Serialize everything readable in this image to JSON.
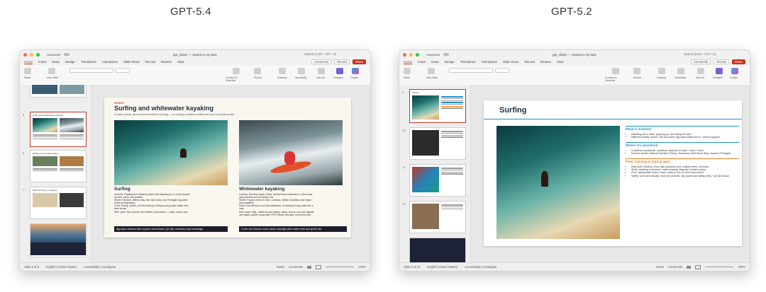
{
  "columns": {
    "left_title": "GPT-5.4",
    "right_title": "GPT-5.2"
  },
  "window": {
    "autosave": "AutoSave",
    "filename": "ppt_slides",
    "saved": "Saved to my Mac",
    "search_placeholder": "Search (Cmd + Ctrl + U)",
    "share": "Share",
    "comments": "Comments",
    "record": "Record",
    "tabs": [
      "Home",
      "Insert",
      "Draw",
      "Design",
      "Transitions",
      "Animations",
      "Slide Show",
      "Record",
      "Review",
      "View"
    ],
    "ribbon": {
      "paste": "Paste",
      "new_slide": "New Slide",
      "convert": "Convert to SmartArt",
      "picture": "Picture",
      "drawing": "Drawing",
      "sensitivity": "Sensitivity",
      "addins": "Add-ins",
      "designer": "Designer",
      "copilot": "Copilot"
    }
  },
  "left": {
    "slide_title": "Surfing and whitewater kayaking",
    "tag": "SPORTS",
    "subtitle": "In water sports, the environment itself is moving — so reading conditions matters as much as physical skill.",
    "surf_heading": "Surfing",
    "surf_text_1": "Involves: Paddling into breaking waves and standing up on a fine shaped",
    "surf_text_2": "by wind, swell, and seabed.",
    "surf_text_3": "Where: Pipeline, Jeffreys Bay, the Gold Coast, and Portugal's big-wave",
    "surf_text_4": "coast are legendary.",
    "surf_text_5": "Crest: Timing, rhythm, and the feeling of riding moving water rather than",
    "surf_text_6": "fixed terrain.",
    "surf_text_7": "Risk / gear: Rip currents, reef breaks, hold-downs — leash, board, wax.",
    "surf_bar": "Big-wave versions often require rescue teams, jet skis, and deep local knowledge.",
    "kayak_heading": "Whitewater kayaking",
    "kayak_text_1": "Involves: Running rapids, drops, and technical channels in a short boat",
    "kayak_text_2": "using strokes and an Eskimo roll.",
    "kayak_text_3": "Where: Popular rivers in Chile, Colorado, British Columbia, and Nepal",
    "kayak_text_4": "draw paddlers.",
    "kayak_text_5": "Draw: Fast decisions and the satisfaction of reading moving water like a",
    "kayak_text_6": "map.",
    "kayak_text_7": "Risk / gear: High - Skills include edging, rolling, rescue, and river signals;",
    "kayak_text_8": "use kayak, paddle, spray skirt, PFD, helmet, dry gear, and throw rope.",
    "kayak_bar": "A river can become much harder overnight when water level and speed rise.",
    "thumb_labels": [
      "5",
      "6",
      "7"
    ],
    "thumb_slide6_title": "Hiking and mountain biking",
    "thumb_slide7_title": "Wild swimming + beaches",
    "status": {
      "slide": "Slide 5 of 8",
      "language": "English (United States)",
      "accessibility": "Accessibility: Investigate",
      "notes": "Notes",
      "comments": "Comments",
      "zoom": "100%"
    }
  },
  "right": {
    "slide_title": "Surfing",
    "thumb_labels": [
      "9",
      "10",
      "11",
      "12"
    ],
    "thumb_slide9_title": "Surfing",
    "sections": [
      {
        "title": "What it involves",
        "bullets": [
          "Paddling into a wave, popping up, and riding the face",
          "Different breaks: beach, reef and point; big-wave adds tow-in + rescue support"
        ]
      },
      {
        "title": "Where it's practiced",
        "bullets": [
          "Coastlines worldwide; conditions depend on swell + wind + tides",
          "Famous breaks: Banzai Pipeline (O'ahu), Mavericks (Half Moon Bay), Nazaré (Portugal)"
        ]
      },
      {
        "title": "Risk, training & typical gear",
        "bullets": [
          "Risk level: Medium–Very high (powerful surf, shallow reefs, currents)",
          "Skills: paddling endurance, wave reading, etiquette, breath control",
          "Gear: appropriate board, leash, wetsuit; fins for drive and control",
          "Safety: surf with a buddy, know rip currents; big waves use safety vests + jet ski rescue"
        ]
      }
    ],
    "status": {
      "slide": "Slide 9 of 13",
      "language": "English (United States)",
      "accessibility": "Accessibility: Investigate",
      "notes": "Notes",
      "comments": "Comments",
      "zoom": "100%"
    }
  },
  "colors": {
    "share_red": "#c8321c",
    "section_blue": "#1f8fd1",
    "section_orange": "#e67e22",
    "selected_thumb": "#c0392b"
  }
}
